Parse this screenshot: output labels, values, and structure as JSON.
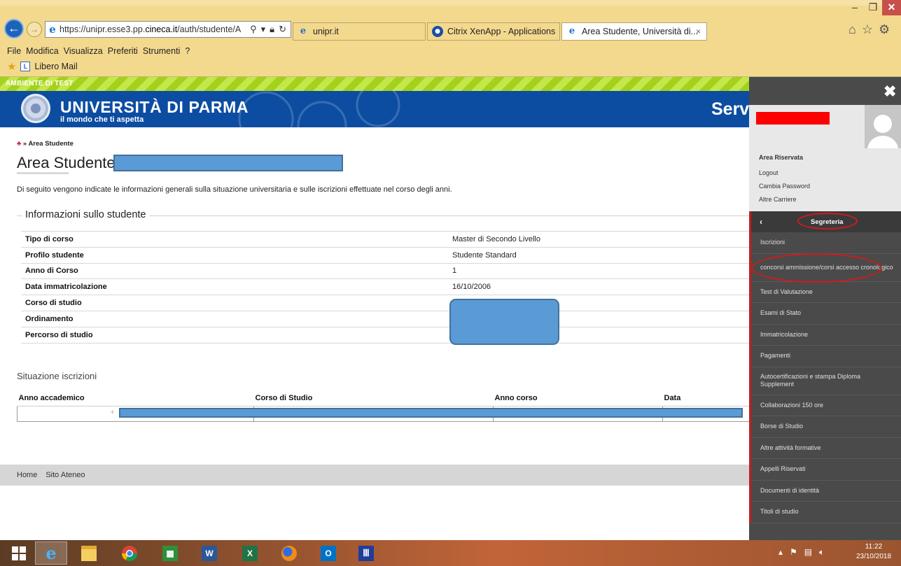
{
  "browser": {
    "window_controls": {
      "minimize": "–",
      "maximize": "❐",
      "close": "✕"
    },
    "address_url_domain_prefix": "https://unipr.esse3.pp.",
    "address_url_domain_bold": "cineca.it",
    "address_url_path": "/auth/studente/A",
    "tabs": [
      {
        "title": "unipr.it",
        "icon": "ie-icon"
      },
      {
        "title": "Citrix XenApp - Applications",
        "icon": "citrix-icon"
      },
      {
        "title": "Area Studente, Università di...",
        "icon": "ie-icon"
      }
    ],
    "tab_close": "×",
    "menu": [
      "File",
      "Modifica",
      "Visualizza",
      "Preferiti",
      "Strumenti",
      "?"
    ],
    "favorites": [
      {
        "label": "Libero Mail"
      }
    ]
  },
  "page": {
    "test_banner": "AMBIENTE DI TEST",
    "university_name": "UNIVERSITÀ DI PARMA",
    "university_tagline": "il mondo che ti aspetta",
    "header_right": "Servi",
    "breadcrumb": "» Area Studente",
    "title": "Area Studente",
    "intro": "Di seguito vengono indicate le informazioni generali sulla situazione universitaria e sulle iscrizioni effettuate nel corso degli anni.",
    "info_section_title": "Informazioni sullo studente",
    "info_rows": [
      {
        "label": "Tipo di corso",
        "value": "Master di Secondo Livello"
      },
      {
        "label": "Profilo studente",
        "value": "Studente Standard"
      },
      {
        "label": "Anno di Corso",
        "value": "1"
      },
      {
        "label": "Data immatricolazione",
        "value": "16/10/2006"
      },
      {
        "label": "Corso di studio",
        "value": ""
      },
      {
        "label": "Ordinamento",
        "value": ""
      },
      {
        "label": "Percorso di studio",
        "value": ""
      }
    ],
    "situation_title": "Situazione iscrizioni",
    "situation_headers": [
      "Anno accademico",
      "Corso di Studio",
      "Anno corso",
      "Data"
    ],
    "situation_expand": "+",
    "footer_links": [
      "Home",
      "Sito Ateneo"
    ]
  },
  "side_panel": {
    "close": "✖",
    "area_riservata": "Area Riservata",
    "links": [
      "Logout",
      "Cambia Password",
      "Altre Carriere"
    ],
    "section_back": "‹",
    "section_title": "Segreteria",
    "menu": [
      "Iscrizioni",
      "concorsi ammissione/corsi accesso cronologico",
      "Test di Valutazione",
      "Esami di Stato",
      "Immatricolazione",
      "Pagamenti",
      "Autocertificazioni e stampa Diploma Supplement",
      "Collaborazioni 150 ore",
      "Borse di Studio",
      "Altre attività formative",
      "Appelli Riservati",
      "Documenti di identità",
      "Titoli di studio"
    ]
  },
  "taskbar": {
    "apps": [
      "windows-start",
      "internet-explorer",
      "file-explorer",
      "chrome",
      "calculator",
      "word",
      "excel",
      "firefox",
      "outlook",
      "bank-app"
    ],
    "time": "11:22",
    "date": "23/10/2018"
  },
  "colors": {
    "chrome": "#f3d98e",
    "uni_blue": "#0c4da2",
    "test_green": "#a3d11c",
    "side_dark": "#4a4a4a",
    "annotation_red": "#d31a1a",
    "redaction_blue": "#5b9bd5"
  }
}
